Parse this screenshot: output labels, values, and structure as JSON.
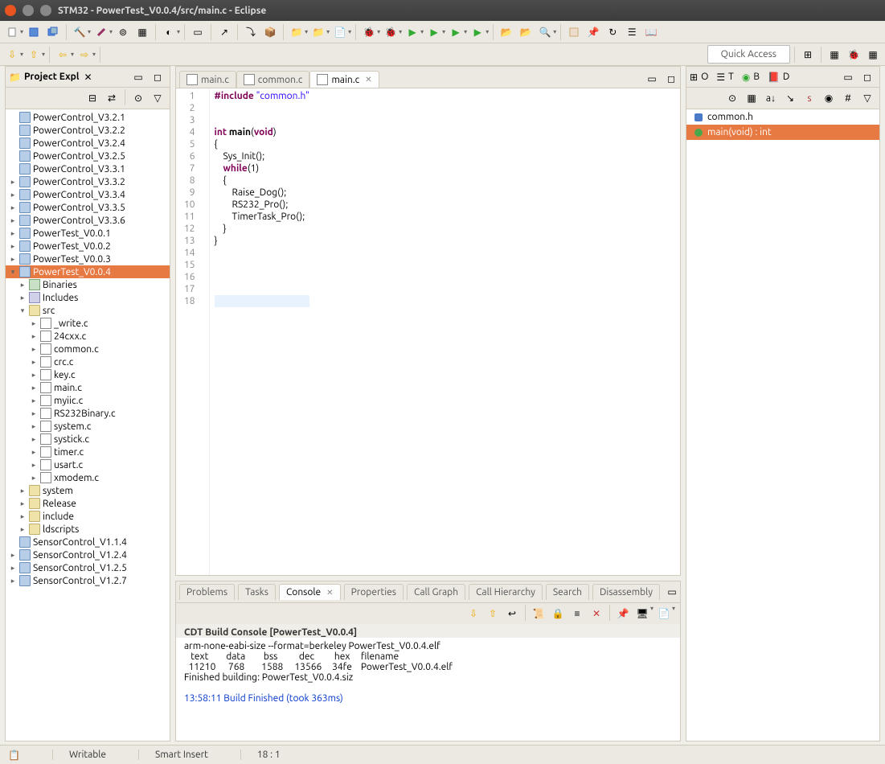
{
  "window": {
    "title": "STM32 - PowerTest_V0.0.4/src/main.c - Eclipse"
  },
  "quick_access": "Quick Access",
  "project_explorer": {
    "title": "Project Expl",
    "items": [
      {
        "t": "p",
        "l": "PowerControl_V3.2.1",
        "a": ""
      },
      {
        "t": "p",
        "l": "PowerControl_V3.2.2",
        "a": ""
      },
      {
        "t": "p",
        "l": "PowerControl_V3.2.4",
        "a": ""
      },
      {
        "t": "p",
        "l": "PowerControl_V3.2.5",
        "a": ""
      },
      {
        "t": "p",
        "l": "PowerControl_V3.3.1",
        "a": ""
      },
      {
        "t": "p",
        "l": "PowerControl_V3.3.2",
        "a": "▸"
      },
      {
        "t": "p",
        "l": "PowerControl_V3.3.4",
        "a": "▸"
      },
      {
        "t": "p",
        "l": "PowerControl_V3.3.5",
        "a": "▸"
      },
      {
        "t": "p",
        "l": "PowerControl_V3.3.6",
        "a": "▸"
      },
      {
        "t": "p",
        "l": "PowerTest_V0.0.1",
        "a": "▸"
      },
      {
        "t": "p",
        "l": "PowerTest_V0.0.2",
        "a": "▸"
      },
      {
        "t": "p",
        "l": "PowerTest_V0.0.3",
        "a": "▸"
      },
      {
        "t": "p",
        "l": "PowerTest_V0.0.4",
        "a": "▾",
        "sel": true
      },
      {
        "t": "b",
        "l": "Binaries",
        "a": "▸",
        "i": 1
      },
      {
        "t": "i",
        "l": "Includes",
        "a": "▸",
        "i": 1
      },
      {
        "t": "f",
        "l": "src",
        "a": "▾",
        "i": 1
      },
      {
        "t": "c",
        "l": "_write.c",
        "a": "▸",
        "i": 2
      },
      {
        "t": "c",
        "l": "24cxx.c",
        "a": "▸",
        "i": 2
      },
      {
        "t": "c",
        "l": "common.c",
        "a": "▸",
        "i": 2
      },
      {
        "t": "c",
        "l": "crc.c",
        "a": "▸",
        "i": 2
      },
      {
        "t": "c",
        "l": "key.c",
        "a": "▸",
        "i": 2
      },
      {
        "t": "c",
        "l": "main.c",
        "a": "▸",
        "i": 2
      },
      {
        "t": "c",
        "l": "myiic.c",
        "a": "▸",
        "i": 2
      },
      {
        "t": "c",
        "l": "RS232Binary.c",
        "a": "▸",
        "i": 2
      },
      {
        "t": "c",
        "l": "system.c",
        "a": "▸",
        "i": 2
      },
      {
        "t": "c",
        "l": "systick.c",
        "a": "▸",
        "i": 2
      },
      {
        "t": "c",
        "l": "timer.c",
        "a": "▸",
        "i": 2
      },
      {
        "t": "c",
        "l": "usart.c",
        "a": "▸",
        "i": 2
      },
      {
        "t": "c",
        "l": "xmodem.c",
        "a": "▸",
        "i": 2
      },
      {
        "t": "f",
        "l": "system",
        "a": "▸",
        "i": 1
      },
      {
        "t": "f",
        "l": "Release",
        "a": "▸",
        "i": 1
      },
      {
        "t": "f",
        "l": "include",
        "a": "▸",
        "i": 1
      },
      {
        "t": "f",
        "l": "ldscripts",
        "a": "▸",
        "i": 1
      },
      {
        "t": "p",
        "l": "SensorControl_V1.1.4",
        "a": ""
      },
      {
        "t": "p",
        "l": "SensorControl_V1.2.4",
        "a": "▸"
      },
      {
        "t": "p",
        "l": "SensorControl_V1.2.5",
        "a": "▸"
      },
      {
        "t": "p",
        "l": "SensorControl_V1.2.7",
        "a": "▸"
      }
    ]
  },
  "editor_tabs": [
    {
      "l": "main.c",
      "active": false
    },
    {
      "l": "common.c",
      "active": false
    },
    {
      "l": "main.c",
      "active": true
    }
  ],
  "code": {
    "lines": [
      {
        "n": 1,
        "html": "<span class='kw'>#include</span> <span class='str'>\"common.h\"</span>"
      },
      {
        "n": 2,
        "html": ""
      },
      {
        "n": 3,
        "html": ""
      },
      {
        "n": 4,
        "html": "<span class='kw'>int</span> <b>main</b>(<span class='kw'>void</span>)"
      },
      {
        "n": 5,
        "html": "{"
      },
      {
        "n": 6,
        "html": "    Sys_Init();"
      },
      {
        "n": 7,
        "html": "    <span class='kw'>while</span>(1)"
      },
      {
        "n": 8,
        "html": "    {"
      },
      {
        "n": 9,
        "html": "        Raise_Dog();"
      },
      {
        "n": 10,
        "html": "        RS232_Pro();"
      },
      {
        "n": 11,
        "html": "        TimerTask_Pro();"
      },
      {
        "n": 12,
        "html": "    }"
      },
      {
        "n": 13,
        "html": "}"
      },
      {
        "n": 14,
        "html": ""
      },
      {
        "n": 15,
        "html": ""
      },
      {
        "n": 16,
        "html": ""
      },
      {
        "n": 17,
        "html": ""
      },
      {
        "n": 18,
        "html": "<span class='current-line'>&#8203;</span>"
      }
    ]
  },
  "bottom_tabs": [
    "Problems",
    "Tasks",
    "Console",
    "Properties",
    "Call Graph",
    "Call Hierarchy",
    "Search",
    "Disassembly"
  ],
  "bottom_active": "Console",
  "console": {
    "title": "CDT Build Console [PowerTest_V0.0.4]",
    "lines": [
      "arm-none-eabi-size --format=berkeley PowerTest_V0.0.4.elf",
      "   text\t   data\t    bss\t    dec\t    hex\tfilename",
      "  11210\t    768\t   1588\t  13566\t   34fe\tPowerTest_V0.0.4.elf",
      "Finished building: PowerTest_V0.0.4.siz",
      " ",
      "",
      "13:58:11 Build Finished (took 363ms)"
    ]
  },
  "outline_tabs": {
    "o": "O",
    "t": "T",
    "b": "B",
    "d": "D"
  },
  "outline": [
    {
      "l": "common.h",
      "sel": false,
      "dot": "blue"
    },
    {
      "l": "main(void) : int",
      "sel": true,
      "dot": "green"
    }
  ],
  "status": {
    "writable": "Writable",
    "ins": "Smart Insert",
    "pos": "18 : 1"
  }
}
